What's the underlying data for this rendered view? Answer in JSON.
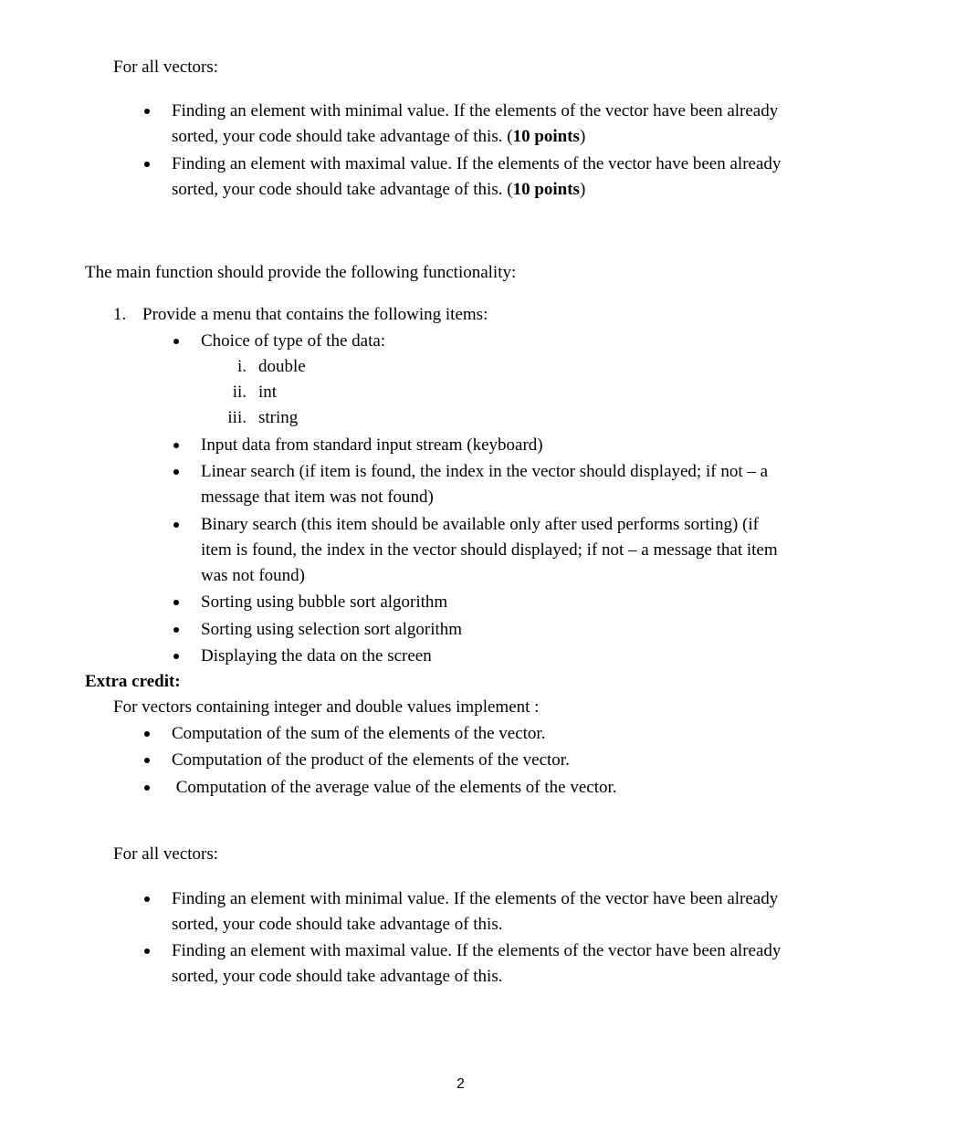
{
  "section1": {
    "heading": "For all vectors:",
    "items": [
      {
        "line1": "Finding an element with minimal value. If the elements of the vector have been already",
        "line2_pre": "sorted, your code should take advantage of this. (",
        "bold": "10 points",
        "line2_post": ")"
      },
      {
        "line1": "Finding an element with maximal value. If the elements of the vector have been already",
        "line2_pre": "sorted, your code should take advantage of this. (",
        "bold": "10 points",
        "line2_post": ")"
      }
    ]
  },
  "main_section": {
    "intro": "The main function should provide the following functionality:",
    "numbered_marker": "1.",
    "numbered_text": "Provide a menu that contains the following items:",
    "menu_items": [
      {
        "lines": [
          "Choice of type of the data:"
        ]
      },
      {
        "lines": [
          "Input data from standard input stream (keyboard)"
        ]
      },
      {
        "lines": [
          "Linear search (if item is found, the index in the vector should displayed; if not – a",
          "message that item was not found)"
        ]
      },
      {
        "lines": [
          "Binary search (this item should be available only after used performs sorting) (if",
          "item is found, the index in the vector should displayed; if not – a message that item",
          "was not found)"
        ]
      },
      {
        "lines": [
          "Sorting using bubble sort algorithm"
        ]
      },
      {
        "lines": [
          "Sorting using selection sort algorithm"
        ]
      },
      {
        "lines": [
          "Displaying the data on the screen"
        ]
      }
    ],
    "data_types": [
      {
        "marker": "i.",
        "label": "double"
      },
      {
        "marker": "ii.",
        "label": "int"
      },
      {
        "marker": "iii.",
        "label": "string"
      }
    ]
  },
  "extra_credit": {
    "heading": "Extra credit:",
    "intro": "For vectors containing integer and double values implement :",
    "items": [
      "Computation of the sum of the elements of the vector.",
      "Computation of the product of the elements of the vector.",
      " Computation of the average value of the elements of the vector."
    ]
  },
  "section2": {
    "heading": "For all vectors:",
    "items": [
      {
        "line1": "Finding an element with minimal value. If the elements of the vector have been already",
        "line2": "sorted, your code should take advantage of this."
      },
      {
        "line1": "Finding an element with maximal value. If the elements of the vector have been already",
        "line2": "sorted, your code should take advantage of this."
      }
    ]
  },
  "page_number": "2"
}
